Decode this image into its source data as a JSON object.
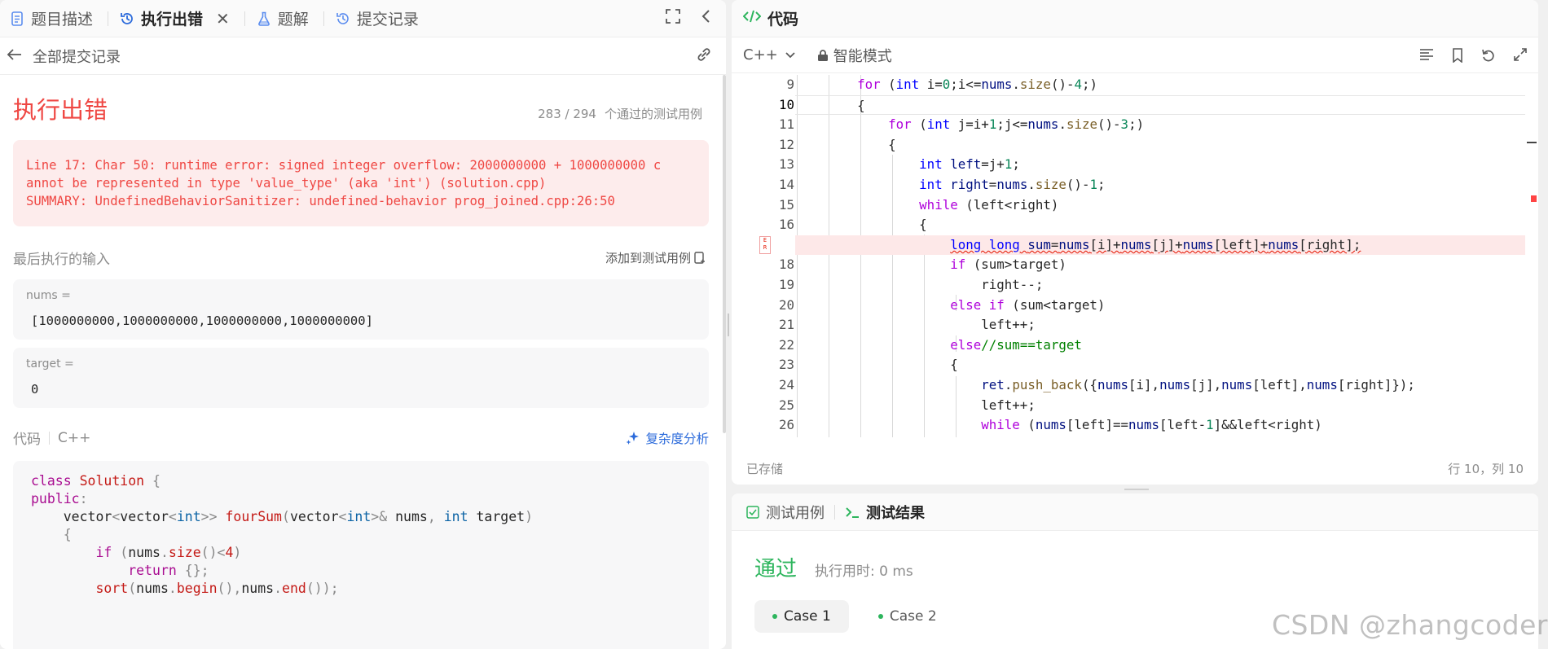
{
  "left_tabs": [
    {
      "label": "题目描述",
      "icon": "document-icon"
    },
    {
      "label": "执行出错",
      "icon": "history-icon",
      "active": true
    },
    {
      "label": "题解",
      "icon": "flask-icon"
    },
    {
      "label": "提交记录",
      "icon": "history-icon"
    }
  ],
  "subbar": {
    "back_label": "全部提交记录"
  },
  "result": {
    "title": "执行出错",
    "count": "283 / 294",
    "count_suffix": "个通过的测试用例",
    "error_lines": [
      "Line 17: Char 50: runtime error: signed integer overflow: 2000000000 + 1000000000 c",
      "annot be represented in type 'value_type' (aka 'int') (solution.cpp)",
      "SUMMARY: UndefinedBehaviorSanitizer: undefined-behavior prog_joined.cpp:26:50"
    ]
  },
  "last_input": {
    "title": "最后执行的输入",
    "add_label": "添加到测试用例",
    "params": [
      {
        "name": "nums =",
        "value": "[1000000000,1000000000,1000000000,1000000000]"
      },
      {
        "name": "target =",
        "value": "0"
      }
    ]
  },
  "code_section": {
    "title": "代码",
    "lang": "C++",
    "complexity_label": "复杂度分析"
  },
  "editor": {
    "title": "代码",
    "lang": "C++",
    "mode": "智能模式",
    "saved": "已存储",
    "cursor": "行 10，列 10"
  },
  "tests": {
    "tab_cases": "测试用例",
    "tab_results": "测试结果",
    "status": "通过",
    "time": "执行用时: 0 ms",
    "cases": [
      "Case 1",
      "Case 2"
    ]
  },
  "watermark": "CSDN @zhangcoder",
  "colors": {
    "error": "#ef4743",
    "success": "#2db55d",
    "link": "#2c6bdb"
  }
}
